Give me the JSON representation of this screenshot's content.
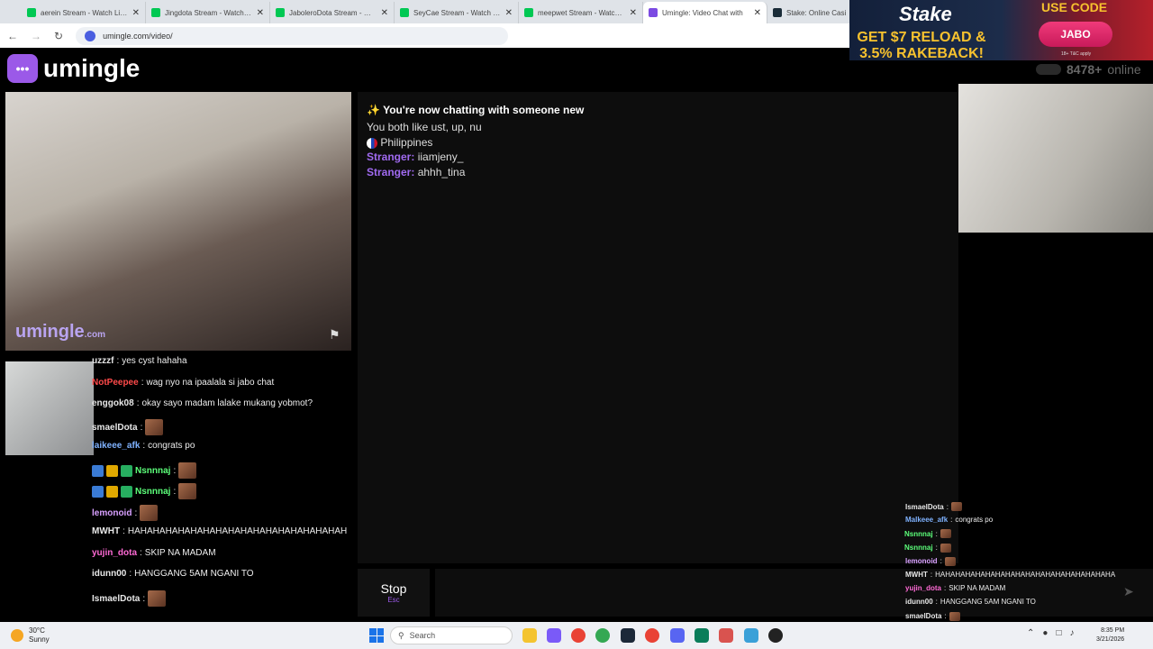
{
  "browser": {
    "tabs": [
      {
        "label": "aerein Stream - Watch Live o",
        "close": "✕",
        "color": "#00c853"
      },
      {
        "label": "Jingdota Stream - Watch Live",
        "close": "✕",
        "color": "#00c853"
      },
      {
        "label": "JaboleroDota Stream - Watch",
        "close": "✕",
        "color": "#00c853"
      },
      {
        "label": "SeyCae Stream - Watch Live",
        "close": "✕",
        "color": "#00c853"
      },
      {
        "label": "meepwet Stream - Watch Liv",
        "close": "✕",
        "color": "#00c853"
      },
      {
        "label": "Umingle: Video Chat with",
        "close": "✕",
        "color": "#7b4ae2"
      },
      {
        "label": "Stake: Online Casi",
        "close": "",
        "color": "#1a2c38"
      }
    ],
    "url": "umingle.com/video/"
  },
  "ad": {
    "brand": "Stake",
    "promo": "GET $7 RELOAD & 3.5% RAKEBACK!",
    "use_code": "USE CODE",
    "code": "JABO",
    "terms": "18+ T&C apply"
  },
  "app": {
    "logo_text": "umingle",
    "online_count": "8478+",
    "online_label": "online",
    "watermark": "umingle",
    "watermark_suffix": ".com"
  },
  "chat": {
    "headline_icon": "✨",
    "headline": "You're now chatting with someone new",
    "interests": "You both like ust, up, nu",
    "country": "Philippines",
    "messages": [
      {
        "who": "Stranger:",
        "text": "iiamjeny_"
      },
      {
        "who": "Stranger:",
        "text": "ahhh_tina"
      }
    ]
  },
  "controls": {
    "stop_label": "Stop",
    "stop_hint": "Esc"
  },
  "twitch_chat": [
    {
      "user": "uzzzf",
      "text": "yes cyst hahaha",
      "color": "#e8e8e8"
    },
    {
      "user": "NotPeepee",
      "text": "wag nyo na ipaalala si jabo chat",
      "color": "#ff4a4a"
    },
    {
      "user": "enggok08",
      "text": "okay sayo madam lalake mukang yobmot?",
      "color": "#e8e8e8"
    },
    {
      "user": "smaelDota",
      "text": "",
      "color": "#e8e8e8"
    },
    {
      "user": "laikeee_afk",
      "text": "congrats po",
      "color": "#7fb2ff"
    },
    {
      "user": "Nsnnnaj",
      "text": "",
      "color": "#5cff7a"
    },
    {
      "user": "Nsnnnaj",
      "text": "",
      "color": "#5cff7a"
    },
    {
      "user": "lemonoid",
      "text": "",
      "color": "#d8a0ff"
    },
    {
      "user": "MWHT",
      "text": "HAHAHAHAHAHAHAHAHAHAHAHAHAHAHAHAHAH",
      "color": "#e8e8e8"
    },
    {
      "user": "yujin_dota",
      "text": "SKIP NA MADAM",
      "color": "#ff6ad5"
    },
    {
      "user": "idunn00",
      "text": "HANGGANG 5AM NGANI TO",
      "color": "#e8e8e8"
    },
    {
      "user": "IsmaelDota",
      "text": "",
      "color": "#e8e8e8"
    }
  ],
  "overlay_chat": [
    {
      "user": "IsmaelDota",
      "text": "",
      "color": "#e8e8e8"
    },
    {
      "user": "Malkeee_afk",
      "text": "congrats po",
      "color": "#7fb2ff"
    },
    {
      "user": "Nsnnnaj",
      "text": "",
      "color": "#5cff7a"
    },
    {
      "user": "Nsnnnaj",
      "text": "",
      "color": "#5cff7a"
    },
    {
      "user": "lemonoid",
      "text": "",
      "color": "#d8a0ff"
    },
    {
      "user": "MWHT",
      "text": "HAHAHAHAHAHAHAHAHAHAHAHAHAHAHAHAHAHA",
      "color": "#e8e8e8"
    },
    {
      "user": "yujin_dota",
      "text": "SKIP NA MADAM",
      "color": "#ff6ad5"
    },
    {
      "user": "idunn00",
      "text": "HANGGANG 5AM NGANI TO",
      "color": "#e8e8e8"
    },
    {
      "user": "smaelDota",
      "text": "",
      "color": "#e8e8e8"
    }
  ],
  "taskbar": {
    "temp": "30°C",
    "condition": "Sunny",
    "search_placeholder": "Search",
    "time": "8:35 PM",
    "date": "3/21/2026"
  }
}
